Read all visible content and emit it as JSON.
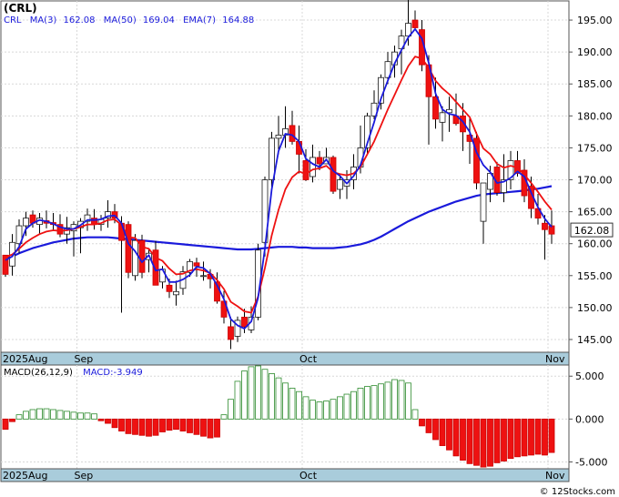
{
  "symbol": "(CRL)",
  "legend": {
    "ticker": "CRL",
    "ma3_label": "MA(3)",
    "ma3_value": "162.08",
    "ma50_label": "MA(50)",
    "ma50_value": "169.04",
    "ema7_label": "EMA(7)",
    "ema7_value": "164.88"
  },
  "last_price": "162.08",
  "macd_legend": {
    "label": "MACD(26,12,9)",
    "value_label": "MACD:-3.949"
  },
  "months": {
    "top": [
      {
        "label": "2025Aug",
        "index": 0
      },
      {
        "label": "Sep",
        "index": 11
      },
      {
        "label": "Oct",
        "index": 44
      },
      {
        "label": "Nov",
        "index": 80
      }
    ],
    "bottom": [
      {
        "label": "2025Aug",
        "index": 0
      },
      {
        "label": "Sep",
        "index": 11
      },
      {
        "label": "Oct",
        "index": 44
      },
      {
        "label": "Nov",
        "index": 80
      }
    ]
  },
  "watermark": "© 12Stocks.com",
  "colors": {
    "up": "#ffffff",
    "down": "#ee1111",
    "ma50": "#1a1adb",
    "ema7": "#ee1111",
    "ma3": "#1a1adb",
    "axis_band": "#a9ccdb",
    "macd_up": "#2e8b2e"
  },
  "chart_data": [
    {
      "type": "candlestick",
      "y_axis": {
        "min": 143,
        "max": 198,
        "ticks": [
          "145.00",
          "150.00",
          "155.00",
          "160.00",
          "165.00",
          "170.00",
          "175.00",
          "180.00",
          "185.00",
          "190.00",
          "195.00"
        ]
      },
      "candles": [
        [
          158.2,
          157.5,
          154.8,
          155.2
        ],
        [
          156.5,
          161.5,
          155.0,
          160.2
        ],
        [
          160.0,
          163.8,
          158.5,
          162.8
        ],
        [
          162.8,
          165.0,
          161.2,
          164.0
        ],
        [
          164.5,
          165.2,
          162.5,
          163.2
        ],
        [
          163.0,
          164.8,
          161.5,
          164.0
        ],
        [
          163.6,
          165.2,
          162.4,
          163.2
        ],
        [
          163.3,
          164.8,
          162.0,
          163.0
        ],
        [
          163.0,
          164.6,
          161.0,
          161.5
        ],
        [
          161.5,
          164.2,
          160.0,
          162.5
        ],
        [
          162.0,
          163.5,
          158.0,
          163.0
        ],
        [
          162.5,
          164.0,
          158.5,
          163.5
        ],
        [
          163.5,
          165.5,
          162.0,
          164.5
        ],
        [
          164.0,
          165.4,
          162.2,
          163.0
        ],
        [
          163.0,
          164.5,
          162.0,
          163.8
        ],
        [
          164.0,
          166.8,
          162.5,
          165.0
        ],
        [
          165.0,
          166.2,
          163.2,
          164.0
        ],
        [
          163.2,
          164.3,
          149.2,
          160.5
        ],
        [
          163.0,
          163.5,
          154.6,
          155.5
        ],
        [
          155.0,
          161.5,
          154.2,
          160.5
        ],
        [
          160.5,
          161.4,
          154.6,
          155.5
        ],
        [
          157.5,
          159.2,
          155.5,
          158.5
        ],
        [
          159.0,
          160.4,
          156.2,
          153.5
        ],
        [
          154.0,
          156.5,
          153.0,
          156.0
        ],
        [
          153.5,
          154.5,
          151.5,
          152.5
        ],
        [
          152.0,
          154.2,
          150.3,
          152.5
        ],
        [
          153.0,
          156.5,
          152.0,
          155.6
        ],
        [
          155.5,
          157.6,
          154.8,
          157.2
        ],
        [
          157.0,
          157.8,
          154.8,
          156.5
        ],
        [
          155.0,
          157.2,
          154.2,
          155.0
        ],
        [
          155.2,
          156.0,
          153.0,
          154.5
        ],
        [
          154.0,
          155.5,
          150.6,
          151.0
        ],
        [
          151.0,
          152.6,
          147.5,
          148.5
        ],
        [
          147.0,
          148.5,
          143.5,
          145.0
        ],
        [
          145.5,
          148.6,
          144.6,
          148.0
        ],
        [
          148.5,
          149.8,
          146.0,
          147.0
        ],
        [
          146.5,
          150.2,
          146.0,
          148.5
        ],
        [
          148.5,
          160.0,
          148.0,
          159.0
        ],
        [
          160.2,
          170.5,
          158.0,
          170.0
        ],
        [
          170.0,
          177.5,
          168.8,
          176.5
        ],
        [
          176.5,
          180.0,
          174.0,
          177.0
        ],
        [
          177.0,
          181.5,
          175.0,
          178.0
        ],
        [
          178.5,
          180.8,
          175.5,
          176.0
        ],
        [
          176.0,
          178.5,
          171.0,
          174.0
        ],
        [
          173.0,
          174.8,
          169.8,
          170.0
        ],
        [
          170.5,
          175.5,
          169.6,
          173.5
        ],
        [
          173.5,
          174.5,
          171.5,
          172.5
        ],
        [
          172.5,
          175.0,
          172.5,
          173.5
        ],
        [
          173.5,
          173.8,
          167.8,
          168.2
        ],
        [
          168.5,
          170.8,
          167.0,
          170.0
        ],
        [
          169.0,
          171.5,
          167.0,
          170.0
        ],
        [
          170.0,
          174.0,
          168.5,
          172.0
        ],
        [
          172.0,
          178.5,
          171.0,
          175.0
        ],
        [
          175.0,
          180.5,
          174.0,
          180.0
        ],
        [
          180.0,
          184.0,
          179.5,
          182.0
        ],
        [
          182.0,
          186.5,
          181.0,
          186.0
        ],
        [
          186.0,
          190.0,
          185.0,
          188.5
        ],
        [
          188.0,
          191.0,
          186.0,
          190.0
        ],
        [
          190.5,
          193.5,
          186.5,
          192.5
        ],
        [
          192.5,
          198.5,
          191.0,
          194.5
        ],
        [
          195.0,
          196.5,
          193.5,
          193.8
        ],
        [
          193.5,
          195.0,
          187.0,
          188.0
        ],
        [
          188.0,
          189.5,
          175.5,
          183.0
        ],
        [
          183.0,
          186.0,
          178.0,
          179.5
        ],
        [
          179.0,
          181.5,
          176.0,
          180.5
        ],
        [
          180.5,
          183.0,
          177.5,
          181.0
        ],
        [
          180.0,
          183.5,
          178.5,
          178.8
        ],
        [
          180.0,
          182.0,
          174.5,
          177.5
        ],
        [
          177.0,
          179.8,
          172.5,
          176.0
        ],
        [
          176.5,
          177.5,
          168.5,
          169.5
        ],
        [
          163.5,
          163.5,
          160.0,
          169.5
        ],
        [
          168.5,
          172.2,
          166.5,
          171.0
        ],
        [
          172.0,
          172.8,
          167.5,
          168.0
        ],
        [
          168.0,
          174.0,
          166.5,
          170.0
        ],
        [
          170.0,
          174.5,
          168.5,
          173.0
        ],
        [
          173.0,
          174.5,
          170.5,
          171.0
        ],
        [
          171.5,
          173.2,
          166.5,
          167.5
        ],
        [
          169.0,
          170.5,
          164.0,
          165.5
        ],
        [
          165.5,
          167.8,
          163.0,
          164.0
        ],
        [
          163.2,
          164.5,
          157.5,
          162.2
        ],
        [
          162.8,
          165.2,
          160.0,
          161.5
        ]
      ],
      "ma50": [
        157.6,
        158.0,
        158.5,
        158.9,
        159.3,
        159.6,
        159.9,
        160.2,
        160.4,
        160.6,
        160.8,
        160.9,
        161.0,
        161.0,
        161.0,
        161.0,
        160.9,
        160.8,
        160.7,
        160.6,
        160.5,
        160.4,
        160.3,
        160.2,
        160.1,
        160.0,
        159.9,
        159.8,
        159.7,
        159.6,
        159.5,
        159.4,
        159.3,
        159.2,
        159.1,
        159.1,
        159.1,
        159.2,
        159.3,
        159.4,
        159.5,
        159.5,
        159.5,
        159.4,
        159.4,
        159.3,
        159.3,
        159.3,
        159.3,
        159.4,
        159.5,
        159.7,
        159.9,
        160.2,
        160.6,
        161.1,
        161.7,
        162.3,
        162.9,
        163.5,
        164.0,
        164.5,
        165.0,
        165.4,
        165.8,
        166.2,
        166.6,
        166.9,
        167.2,
        167.5,
        167.7,
        167.8,
        167.9,
        168.0,
        168.1,
        168.2,
        168.3,
        168.5,
        168.6,
        168.8,
        169.0
      ],
      "ema7": [
        157.9,
        158.3,
        159.2,
        160.2,
        160.9,
        161.5,
        161.9,
        162.1,
        162.0,
        162.1,
        162.3,
        162.6,
        163.0,
        163.0,
        163.2,
        163.7,
        163.8,
        162.9,
        161.0,
        160.9,
        159.5,
        159.2,
        157.8,
        157.3,
        156.1,
        155.2,
        155.3,
        155.8,
        156.0,
        155.8,
        155.4,
        154.3,
        152.9,
        150.9,
        150.2,
        149.4,
        149.2,
        151.7,
        156.2,
        161.3,
        165.3,
        168.5,
        170.4,
        171.3,
        170.9,
        171.6,
        171.8,
        172.2,
        171.2,
        170.9,
        170.7,
        171.0,
        172.0,
        174.0,
        176.0,
        178.5,
        181.0,
        183.3,
        185.6,
        187.8,
        189.3,
        189.0,
        187.5,
        185.5,
        184.3,
        183.4,
        182.2,
        181.0,
        179.8,
        177.2,
        174.9,
        174.0,
        172.5,
        171.9,
        172.2,
        171.9,
        170.8,
        169.5,
        168.1,
        166.6,
        165.3
      ],
      "ma3": [
        157.4,
        158.0,
        159.5,
        162.3,
        163.2,
        163.7,
        163.5,
        163.1,
        162.6,
        162.3,
        162.3,
        162.9,
        163.7,
        163.7,
        163.8,
        164.3,
        164.4,
        163.2,
        160.0,
        158.8,
        157.1,
        158.2,
        155.8,
        156.0,
        154.0,
        154.0,
        154.4,
        155.1,
        156.4,
        156.2,
        155.3,
        153.5,
        151.3,
        148.2,
        147.2,
        146.7,
        147.8,
        151.5,
        159.2,
        168.5,
        174.5,
        177.2,
        177.0,
        176.0,
        173.3,
        172.5,
        172.0,
        173.2,
        171.4,
        170.6,
        169.4,
        170.6,
        172.3,
        175.7,
        179.0,
        182.7,
        185.5,
        188.2,
        190.3,
        192.3,
        193.6,
        192.1,
        188.3,
        183.5,
        181.0,
        180.3,
        180.1,
        179.1,
        177.5,
        174.3,
        172.3,
        171.2,
        169.5,
        169.7,
        170.3,
        171.3,
        170.5,
        168.0,
        165.7,
        163.9,
        162.6
      ]
    },
    {
      "type": "bar",
      "name": "MACD(26,12,9)",
      "y_axis": {
        "min": -5.8,
        "max": 6.3,
        "ticks": [
          "-5.000",
          "0.000",
          "5.000"
        ]
      },
      "values": [
        -1.2,
        -0.3,
        0.5,
        0.9,
        1.1,
        1.2,
        1.2,
        1.1,
        1.0,
        0.9,
        0.8,
        0.7,
        0.7,
        0.6,
        -0.2,
        -0.5,
        -1.0,
        -1.4,
        -1.7,
        -1.8,
        -1.9,
        -2.0,
        -1.9,
        -1.5,
        -1.3,
        -1.2,
        -1.4,
        -1.6,
        -1.8,
        -2.0,
        -2.2,
        -2.1,
        0.5,
        2.3,
        4.4,
        5.6,
        6.1,
        6.2,
        5.8,
        5.3,
        4.8,
        4.2,
        3.6,
        3.2,
        2.6,
        2.2,
        2.0,
        2.1,
        2.3,
        2.6,
        2.9,
        3.2,
        3.6,
        3.8,
        3.9,
        4.1,
        4.3,
        4.6,
        4.5,
        4.2,
        1.1,
        -0.8,
        -1.6,
        -2.4,
        -3.1,
        -3.6,
        -4.3,
        -4.8,
        -5.2,
        -5.4,
        -5.6,
        -5.5,
        -5.1,
        -4.9,
        -4.6,
        -4.4,
        -4.3,
        -4.2,
        -4.1,
        -4.2,
        -3.9
      ]
    }
  ]
}
